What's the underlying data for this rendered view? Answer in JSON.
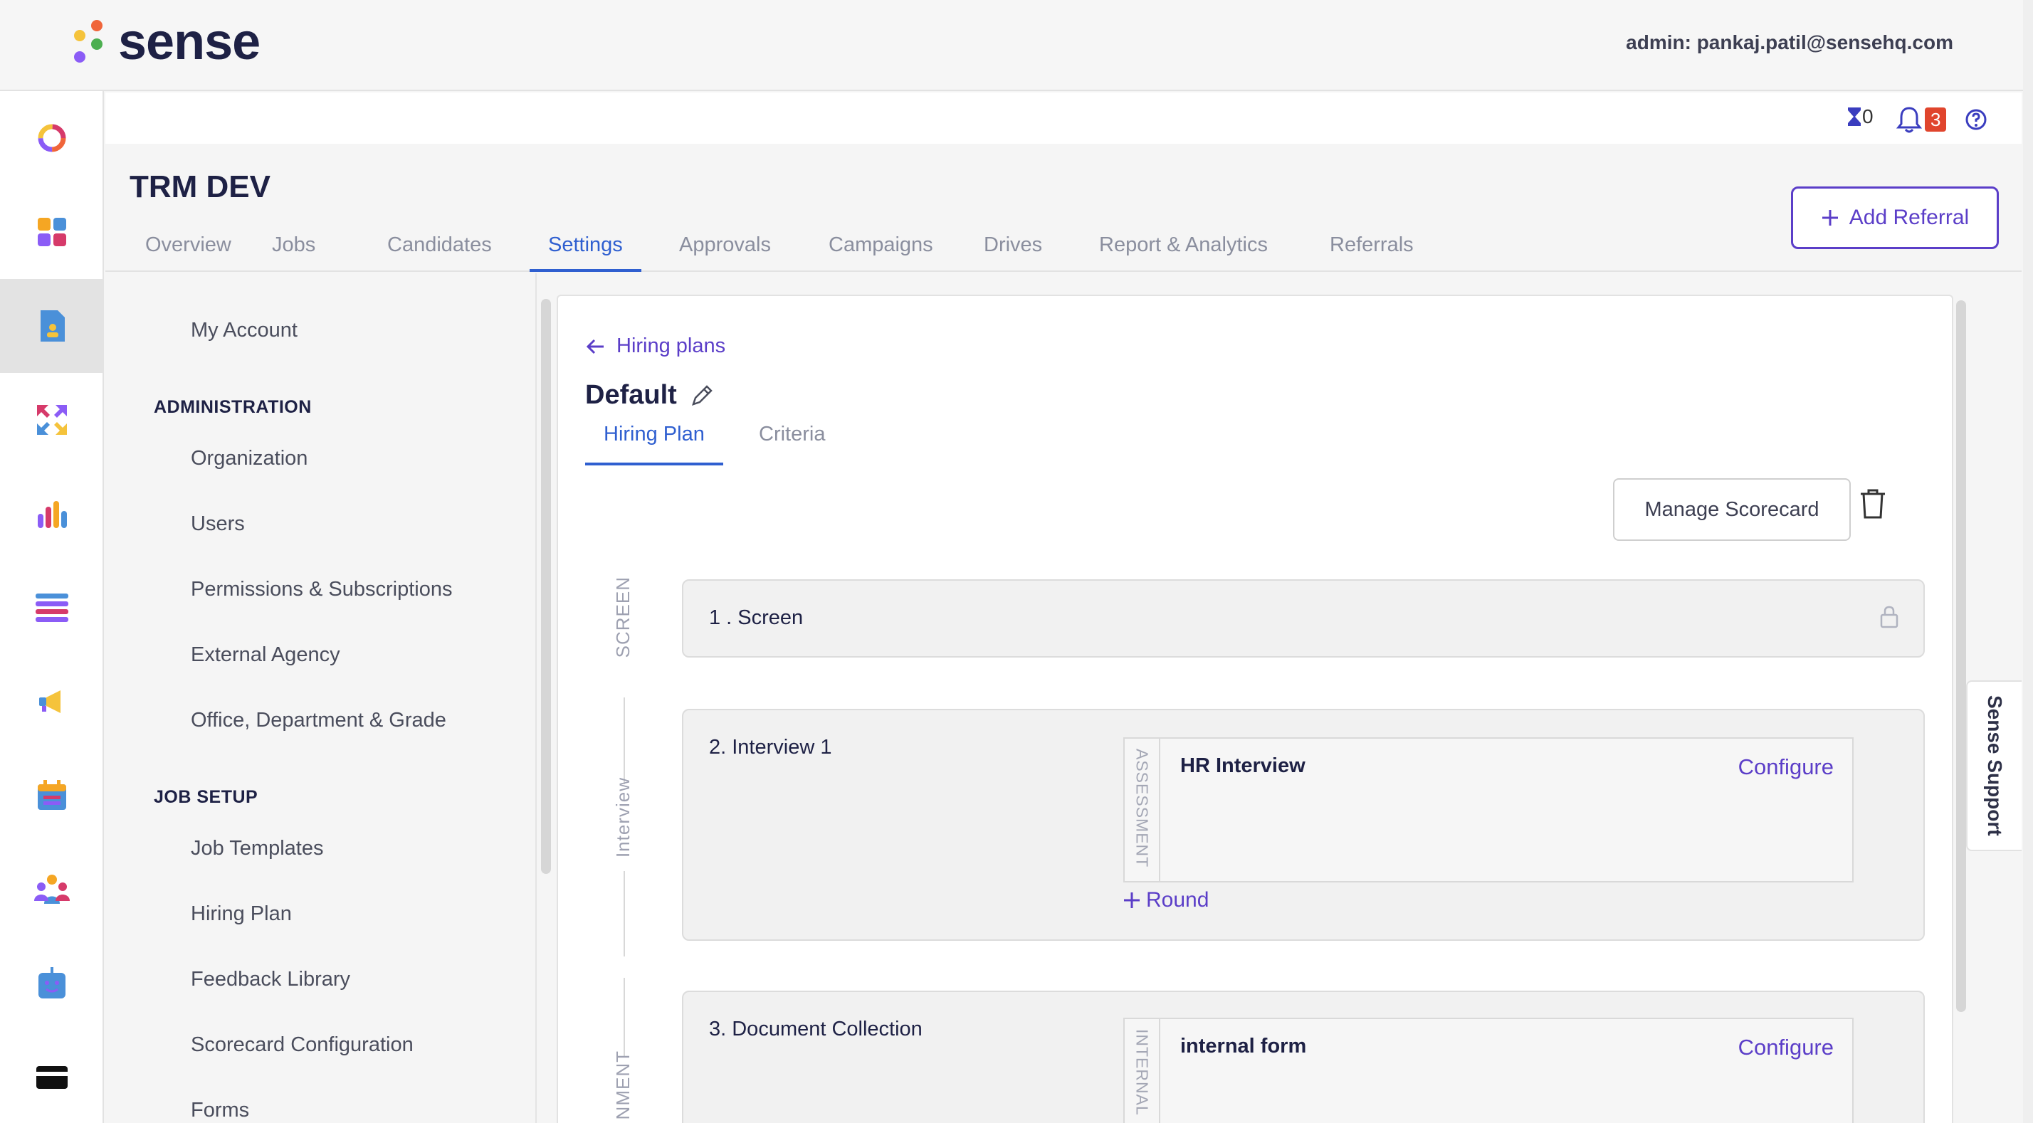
{
  "app": {
    "logo_text": "sense",
    "user_label": "admin: pankaj.patil@sensehq.com"
  },
  "rail": {
    "icons": [
      "dashboard-icon",
      "apps-icon",
      "jobs-icon",
      "transfer-icon",
      "analytics-icon",
      "list-icon",
      "megaphone-icon",
      "calendar-icon",
      "people-icon",
      "bot-icon",
      "card-icon"
    ],
    "active_index": 2
  },
  "utilities": {
    "timer_count": "0",
    "notification_count": "3"
  },
  "project": {
    "title": "TRM DEV",
    "tabs": [
      "Overview",
      "Jobs",
      "Candidates",
      "Settings",
      "Approvals",
      "Campaigns",
      "Drives",
      "Report & Analytics",
      "Referrals"
    ],
    "active_tab": "Settings",
    "add_referral_label": "Add Referral"
  },
  "settings_menu": {
    "top_item": "My Account",
    "sections": [
      {
        "title": "ADMINISTRATION",
        "items": [
          "Organization",
          "Users",
          "Permissions & Subscriptions",
          "External Agency",
          "Office, Department & Grade"
        ]
      },
      {
        "title": "JOB SETUP",
        "items": [
          "Job Templates",
          "Hiring Plan",
          "Feedback Library",
          "Scorecard Configuration",
          "Forms"
        ]
      }
    ]
  },
  "hiring_plan": {
    "back_label": "Hiring plans",
    "plan_name": "Default",
    "sub_tabs": [
      "Hiring Plan",
      "Criteria"
    ],
    "active_sub_tab": "Hiring Plan",
    "manage_scorecard_label": "Manage Scorecard",
    "stages": [
      {
        "label": "SCREEN",
        "rounds": [
          {
            "title": "1 . Screen",
            "locked": true
          }
        ]
      },
      {
        "label": "Interview",
        "rounds": [
          {
            "title": "2. Interview 1",
            "section_label": "ASSESSMENT",
            "items": [
              {
                "name": "HR Interview",
                "action": "Configure"
              }
            ],
            "add_label": "Round"
          }
        ]
      },
      {
        "label": "NMENT",
        "rounds": [
          {
            "title": "3. Document Collection",
            "section_label": "INTERNAL",
            "items": [
              {
                "name": "internal form",
                "action": "Configure"
              }
            ]
          }
        ]
      }
    ]
  },
  "support": {
    "label": "Sense Support"
  },
  "colors": {
    "brand": "#5b3ec8",
    "tab_active": "#2f5fd0",
    "badge": "#e0452d"
  }
}
